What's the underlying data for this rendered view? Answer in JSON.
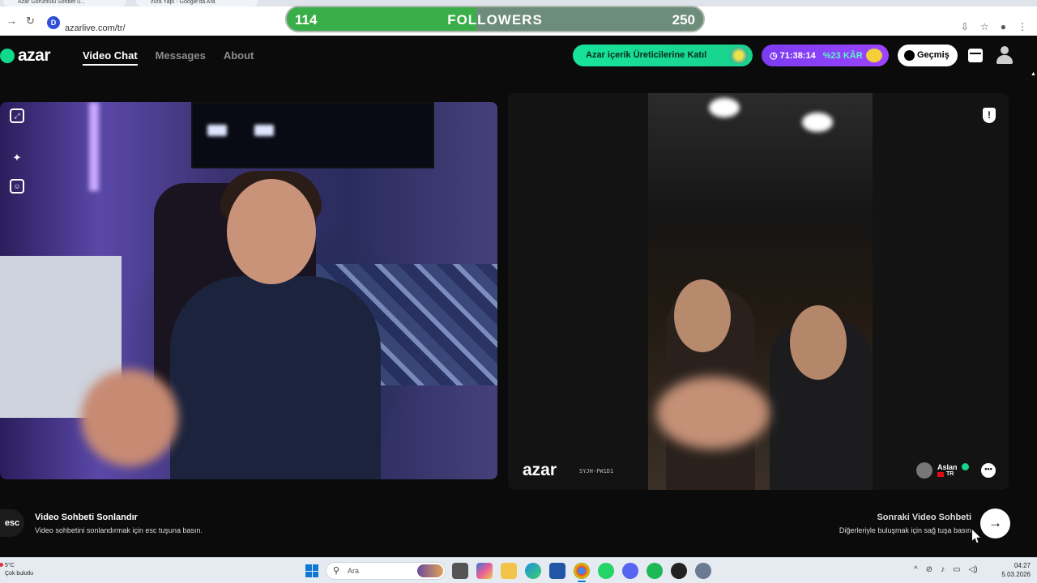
{
  "browser": {
    "tabs": [
      {
        "label": "Azar Görüntülü Sohbet ü..."
      },
      {
        "label": "zura Yapı - Google'da Ara"
      }
    ],
    "url": "azarlive.com/tr/"
  },
  "followers": {
    "current": "114",
    "title": "FOLLOWERS",
    "goal": "250",
    "progress": 0.456
  },
  "header": {
    "logo": "azar",
    "nav": [
      {
        "label": "Video Chat"
      },
      {
        "label": "Messages"
      },
      {
        "label": "About"
      }
    ],
    "creator_button": "Azar içerik Üreticilerine Katıl",
    "timer": "71:38:14",
    "discount": "%23 KÂR",
    "history_button": "Geçmiş"
  },
  "right_panel": {
    "watermark": "azar",
    "code": "SYJH-FW1D1",
    "user": {
      "name": "Aslan",
      "country": "TR"
    }
  },
  "bottom": {
    "esc_key": "esc",
    "end_title": "Video Sohbeti Sonlandır",
    "end_sub": "Video sohbetini sonlandırmak için esc tuşuna basın.",
    "next_title": "Sonraki Video Sohbeti",
    "next_sub": "Diğerleriyle buluşmak için sağ tuşa basın"
  },
  "taskbar": {
    "weather_temp": "5°C",
    "weather_desc": "Çok bulutlu",
    "search_placeholder": "Ara",
    "time": "04:27",
    "date": "5.03.2026"
  },
  "colors": {
    "accent_green": "#19d28e",
    "accent_purple": "#8a40f8",
    "followers_fill": "#3aae49"
  }
}
